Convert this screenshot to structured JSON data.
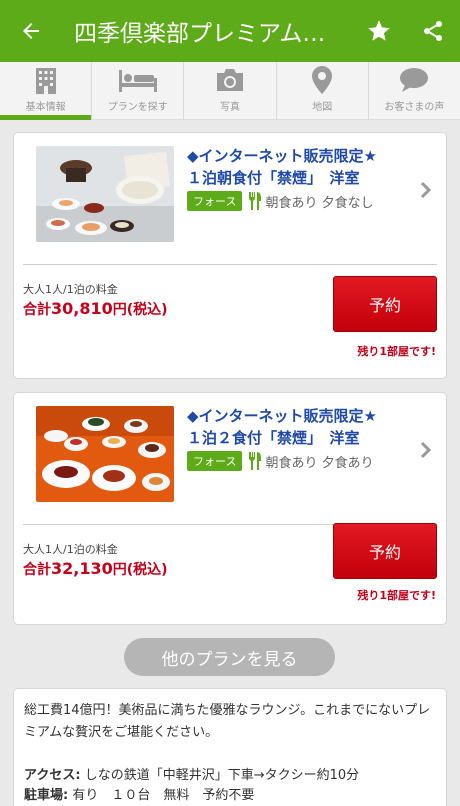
{
  "header": {
    "title": "四季倶楽部プレミアム…",
    "icons": [
      "back-arrow-icon",
      "star-icon",
      "share-icon"
    ]
  },
  "tabs": [
    {
      "label": "基本情報",
      "icon": "building-icon",
      "active": true
    },
    {
      "label": "プランを探す",
      "icon": "bed-icon",
      "active": false
    },
    {
      "label": "写真",
      "icon": "camera-icon",
      "active": false
    },
    {
      "label": "地図",
      "icon": "map-pin-icon",
      "active": false
    },
    {
      "label": "お客さまの声",
      "icon": "speech-bubble-icon",
      "active": false
    }
  ],
  "plans": [
    {
      "name_line1": "◆インターネット販売限定★",
      "name_line2": "１泊朝食付「禁煙」　洋室",
      "tag": "フォース",
      "meals": "朝食あり 夕食なし",
      "price_label": "大人1人/1泊の料金",
      "total_prefix": "合計",
      "total_value": "30,810",
      "total_suffix": "円(税込)",
      "reserve_label": "予約",
      "remaining": "残り1部屋です!"
    },
    {
      "name_line1": "◆インターネット販売限定★",
      "name_line2": "１泊２食付「禁煙」　洋室",
      "tag": "フォース",
      "meals": "朝食あり 夕食あり",
      "price_label": "大人1人/1泊の料金",
      "total_prefix": "合計",
      "total_value": "32,130",
      "total_suffix": "円(税込)",
      "reserve_label": "予約",
      "remaining": "残り1部屋です!"
    }
  ],
  "more_button": "他のプランを見る",
  "description": {
    "text": "総工費14億円！美術品に満ちた優雅なラウンジ。これまでにないプレミアムな贅沢をご堪能ください。",
    "access_label": "アクセス:",
    "access_value": " しなの鉄道「中軽井沢」下車→タクシー約10分",
    "parking_label": "駐車場:",
    "parking_value": " 有り　１０台　無料　予約不要"
  },
  "colors": {
    "brand_green": "#5dab18",
    "link_blue": "#1f4aa8",
    "price_red": "#c4001a",
    "reserve_red": "#d70c15"
  }
}
